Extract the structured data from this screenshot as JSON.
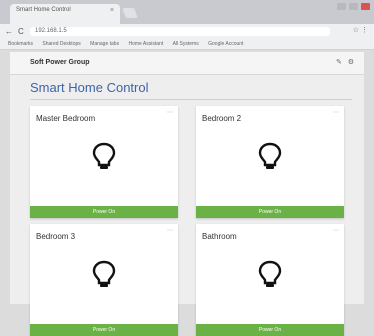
{
  "browser": {
    "tab_title": "Smart Home Control",
    "address": "192.168.1.5",
    "bookmarks": [
      "Bookmarks",
      "Shared Desktops",
      "Manage tabs",
      "Home Assistant",
      "All Systems",
      "Google Account"
    ],
    "colors": {
      "tabbar": "#c8cacf",
      "toolbar": "#eef0f2"
    }
  },
  "app": {
    "brand": "Soft Power Group",
    "title": "Smart Home Control",
    "header_icons": [
      "edit-icon",
      "settings-icon"
    ],
    "colors": {
      "title": "#3d64a8",
      "button": "#6ab146"
    }
  },
  "rooms": [
    {
      "name": "Master Bedroom",
      "button": "Power On",
      "icon": "lightbulb-icon"
    },
    {
      "name": "Bedroom 2",
      "button": "Power On",
      "icon": "lightbulb-icon"
    },
    {
      "name": "Bedroom 3",
      "button": "Power On",
      "icon": "lightbulb-icon"
    },
    {
      "name": "Bathroom",
      "button": "Power On",
      "icon": "lightbulb-icon"
    }
  ]
}
